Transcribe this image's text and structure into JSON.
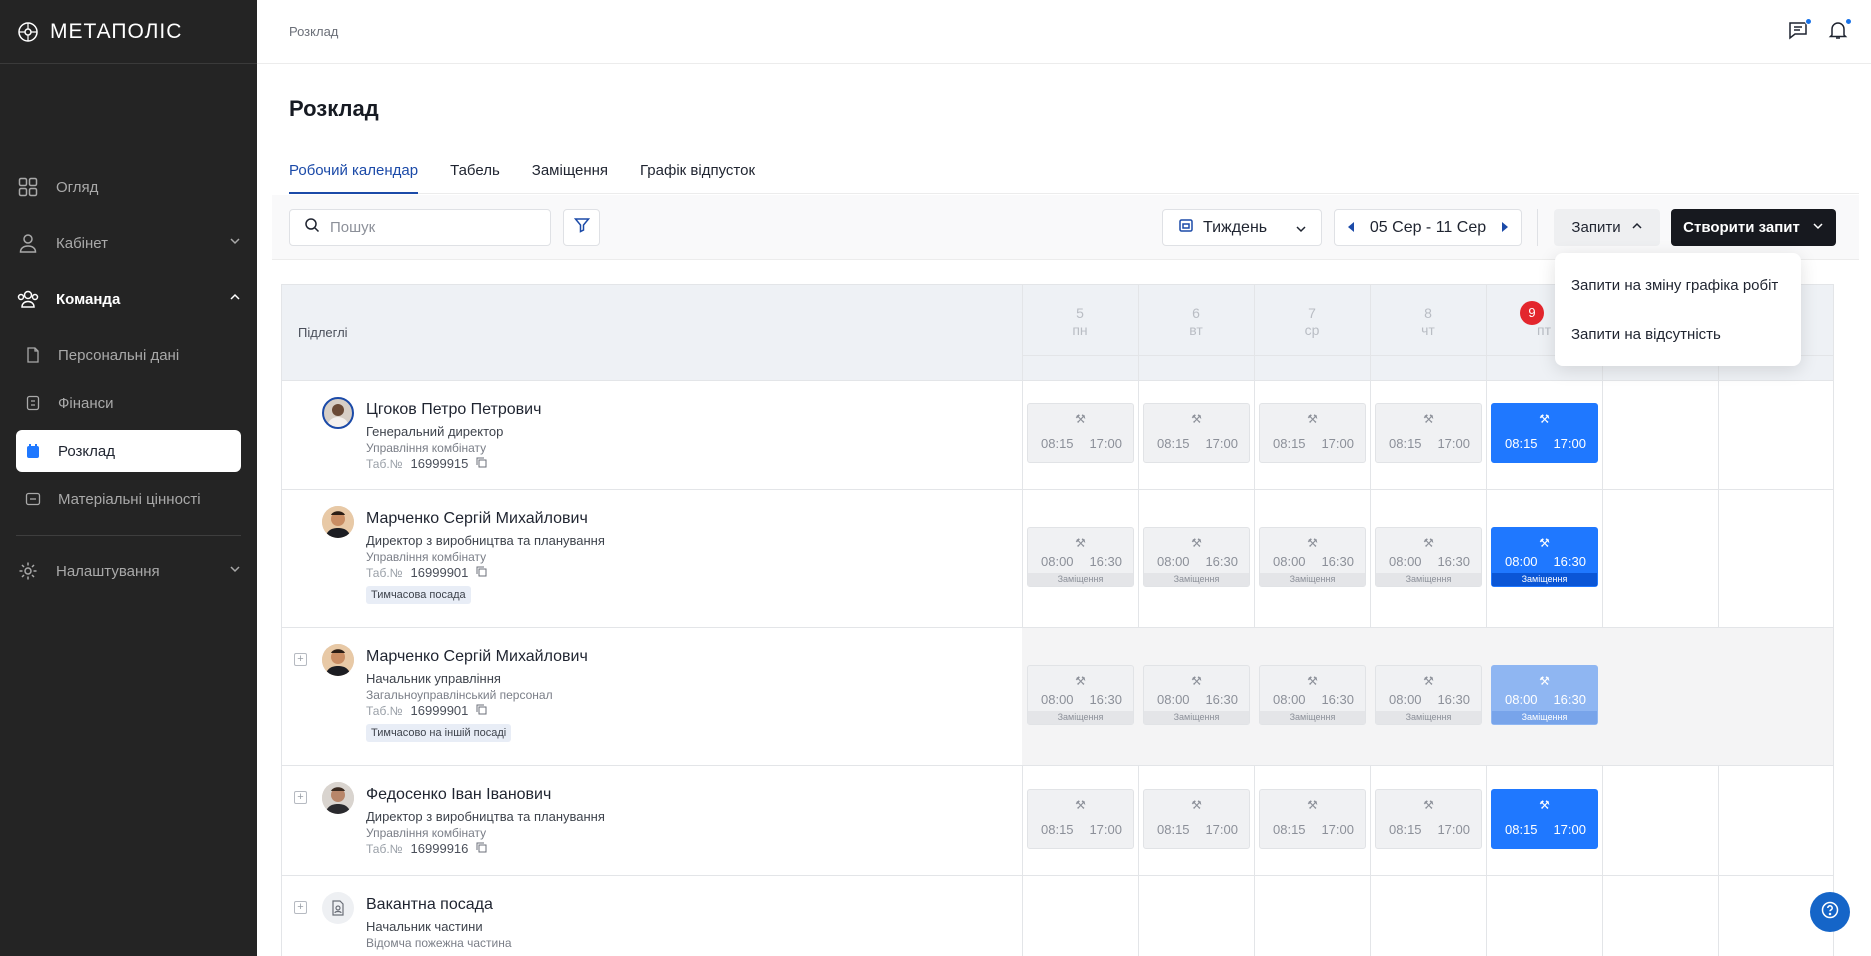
{
  "app": {
    "name": "МЕТАПОЛІС"
  },
  "sidebar": {
    "items": [
      {
        "label": "Огляд",
        "icon": "grid-icon"
      },
      {
        "label": "Кабінет",
        "icon": "user-icon"
      },
      {
        "label": "Команда",
        "icon": "team-icon"
      },
      {
        "label": "Налаштування",
        "icon": "gear-icon"
      }
    ],
    "sub_items": [
      {
        "label": "Персональні дані",
        "icon": "document-icon"
      },
      {
        "label": "Фінанси",
        "icon": "finance-icon"
      },
      {
        "label": "Розклад",
        "icon": "calendar-icon"
      },
      {
        "label": "Матеріальні цінності",
        "icon": "assets-icon"
      }
    ]
  },
  "header": {
    "breadcrumb": "Розклад"
  },
  "page": {
    "title": "Розклад"
  },
  "tabs": [
    "Робочий календар",
    "Табель",
    "Заміщення",
    "Графік відпусток"
  ],
  "toolbar": {
    "search_placeholder": "Пошук",
    "period": "Тиждень",
    "range": "05 Сер - 11 Сер",
    "requests": "Запити",
    "create": "Створити запит"
  },
  "dropdown": [
    "Запити на зміну графіка робіт",
    "Запити на відсутність"
  ],
  "table": {
    "subordinates_label": "Підлеглі",
    "days": [
      {
        "num": "5",
        "wd": "пн"
      },
      {
        "num": "6",
        "wd": "вт"
      },
      {
        "num": "7",
        "wd": "ср"
      },
      {
        "num": "8",
        "wd": "чт"
      },
      {
        "num": "9",
        "wd": "пт"
      }
    ],
    "tab_prefix": "Таб.№",
    "rows": [
      {
        "name": "Цгоков Петро Петрович",
        "position": "Генеральний директор",
        "dept": "Управління комбінату",
        "tab": "16999915",
        "start": "08:15",
        "end": "17:00"
      },
      {
        "name": "Марченко Сергій Михайлович",
        "position": "Директор з виробництва та планування",
        "dept": "Управління комбінату",
        "tab": "16999901",
        "tag": "Тимчасова посада",
        "start": "08:00",
        "end": "16:30",
        "shift_label": "Заміщення"
      },
      {
        "name": "Марченко Сергій Михайлович",
        "position": "Начальник управління",
        "dept": "Загальноуправлінський персонал",
        "tab": "16999901",
        "tag": "Тимчасово на іншій посаді",
        "start": "08:00",
        "end": "16:30",
        "shift_label": "Заміщення"
      },
      {
        "name": "Федосенко Іван Іванович",
        "position": "Директор з виробництва та планування",
        "dept": "Управління комбінату",
        "tab": "16999916",
        "start": "08:15",
        "end": "17:00"
      },
      {
        "name": "Вакантна посада",
        "position": "Начальник частини",
        "dept": "Відомча пожежна частина"
      }
    ]
  }
}
